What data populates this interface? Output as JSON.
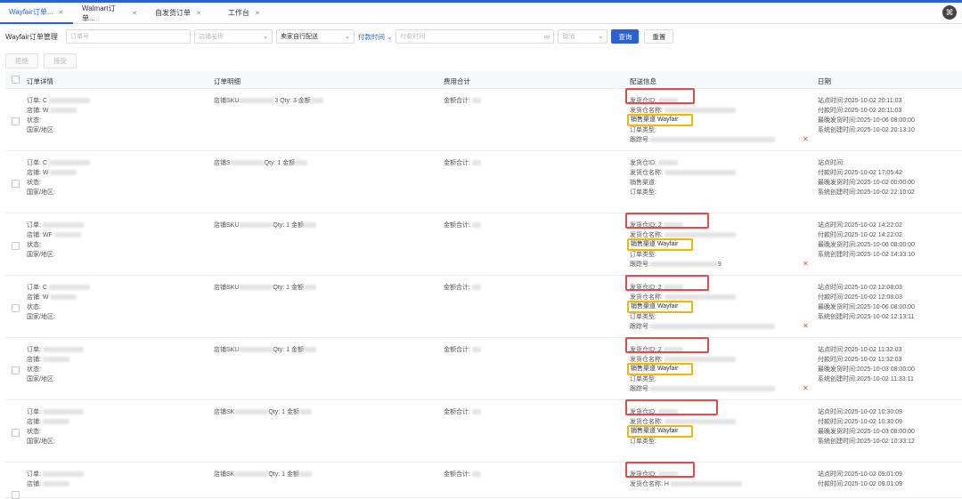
{
  "tabs": [
    {
      "label": "Wayfair订单...",
      "active": true
    },
    {
      "label": "Walmart订单...",
      "active": false
    },
    {
      "label": "自发货订单",
      "active": false
    },
    {
      "label": "工作台",
      "active": false
    }
  ],
  "filter": {
    "title": "Wayfair订单管理",
    "order_placeholder": "订单号",
    "store_placeholder": "店铺名称",
    "delivery_select": "卖家自行配送",
    "time_type": "付款时间",
    "time_placeholder": "付款时间",
    "status_placeholder": "取消",
    "query_label": "查询",
    "reset_label": "重置"
  },
  "actions": {
    "reject": "拒绝",
    "accept": "接受"
  },
  "columns": [
    "订单详情",
    "订单明细",
    "费用合计",
    "配送信息",
    "日期"
  ],
  "rows": [
    {
      "order": "订单: C",
      "store": "店铺: W",
      "status": "状态:",
      "country": "国家/地区:",
      "sku": "店铺SKU:",
      "qty": "3 Qty: 3 金额",
      "fee": "金额合计:",
      "ship1": "发货仓ID:",
      "ship2": "发货仓名称:",
      "channel": "销售渠道 Wayfair",
      "otype": "订单类型:",
      "track": "跟踪号:",
      "d1": "站点时间:2025-10-02 20:11:03",
      "d2": "付款时间:2025-10-02 20:11:03",
      "d3": "最晚发货时间:2025-10-06 08:00:00",
      "d4": "系统创建时间:2025-10-02 20:13:10",
      "boxed": true
    },
    {
      "order": "订单: C",
      "store": "店铺: W",
      "status": "状态:",
      "country": "国家/地区:",
      "sku": "店铺S",
      "qty": "Qty: 1 金额",
      "fee": "金额合计:",
      "ship1": "发货仓ID:",
      "ship2": "发货仓名称:",
      "channel": "销售渠道:",
      "otype": "订单类型:",
      "track": "",
      "d1": "站点时间:",
      "d2": "付款时间:2025-10-02 17:05:42",
      "d3": "最晚发货时间:2025-10-02 00:00:00",
      "d4": "系统创建时间:2025-10-02 22:10:02",
      "boxed": false
    },
    {
      "order": "订单:",
      "store": "店铺: WF",
      "status": "状态:",
      "country": "国家/地区:",
      "sku": "店铺SKU",
      "qty": "Qty: 1 金额",
      "fee": "金额合计:",
      "ship1": "发货仓ID: 2",
      "ship2": "发货仓名称:",
      "channel": "销售渠道 Wayfair",
      "otype": "订单类型:",
      "track": "跟踪号:",
      "track_end": "9",
      "d1": "站点时间:2025-10-02 14:22:02",
      "d2": "付款时间:2025-10-02 14:22:02",
      "d3": "最晚发货时间:2025-10-06 08:00:00",
      "d4": "系统创建时间:2025-10-02 14:33:10",
      "boxed": true
    },
    {
      "order": "订单: C",
      "store": "店铺: W",
      "status": "状态:",
      "country": "国家/地区:",
      "sku": "店铺SKU",
      "qty": "Qty: 1 金额",
      "fee": "金额合计:",
      "ship1": "发货仓ID: 2",
      "ship2": "发货仓名称:",
      "channel": "销售渠道 Wayfair",
      "otype": "订单类型:",
      "track": "跟踪号:",
      "d1": "站点时间:2025-10-02 12:08:03",
      "d2": "付款时间:2025-10-02 12:08:03",
      "d3": "最晚发货时间:2025-10-06 08:00:00",
      "d4": "系统创建时间:2025-10-02 12:13:11",
      "boxed": true
    },
    {
      "order": "订单:",
      "store": "店铺:",
      "status": "状态:",
      "country": "国家/地区:",
      "sku": "店铺SKU",
      "qty": "Qty: 1 金额",
      "fee": "金额合计:",
      "ship1": "发货仓ID: 2",
      "ship2": "发货仓名称:",
      "channel": "销售渠道 Wayfair",
      "otype": "订单类型:",
      "track": "跟踪号:",
      "d1": "站点时间:2025-10-02 11:32:03",
      "d2": "付款时间:2025-10-02 11:32:03",
      "d3": "最晚发货时间:2025-10-03 08:00:00",
      "d4": "系统创建时间:2025-10-02 11:33:11",
      "boxed": true
    },
    {
      "order": "订单:",
      "store": "店铺:",
      "status": "状态:",
      "country": "国家/地区:",
      "sku": "店铺SK",
      "qty": "Qty: 1 金额",
      "fee": "金额合计:",
      "ship1": "发货仓ID:",
      "ship2": "发货仓名称:",
      "channel": "销售渠道 Wayfair",
      "otype": "订单类型:",
      "track": "",
      "d1": "站点时间:2025-10-02 10:30:09",
      "d2": "付款时间:2025-10-02 10:30:09",
      "d3": "最晚发货时间:2025-10-03 08:00:00",
      "d4": "系统创建时间:2025-10-02 10:33:12",
      "boxed": true
    },
    {
      "order": "订单:",
      "store": "店铺:",
      "status": "",
      "country": "",
      "sku": "店铺SK",
      "qty": "Qty: 1 金额",
      "fee": "金额合计:",
      "ship1": "发货仓ID:",
      "ship2": "发货仓名称: H",
      "channel": "",
      "otype": "",
      "track": "",
      "d1": "站点时间:2025-10-02 09:01:09",
      "d2": "付款时间:2025-10-02 09:01:09",
      "d3": "",
      "d4": "",
      "boxed": true
    }
  ]
}
